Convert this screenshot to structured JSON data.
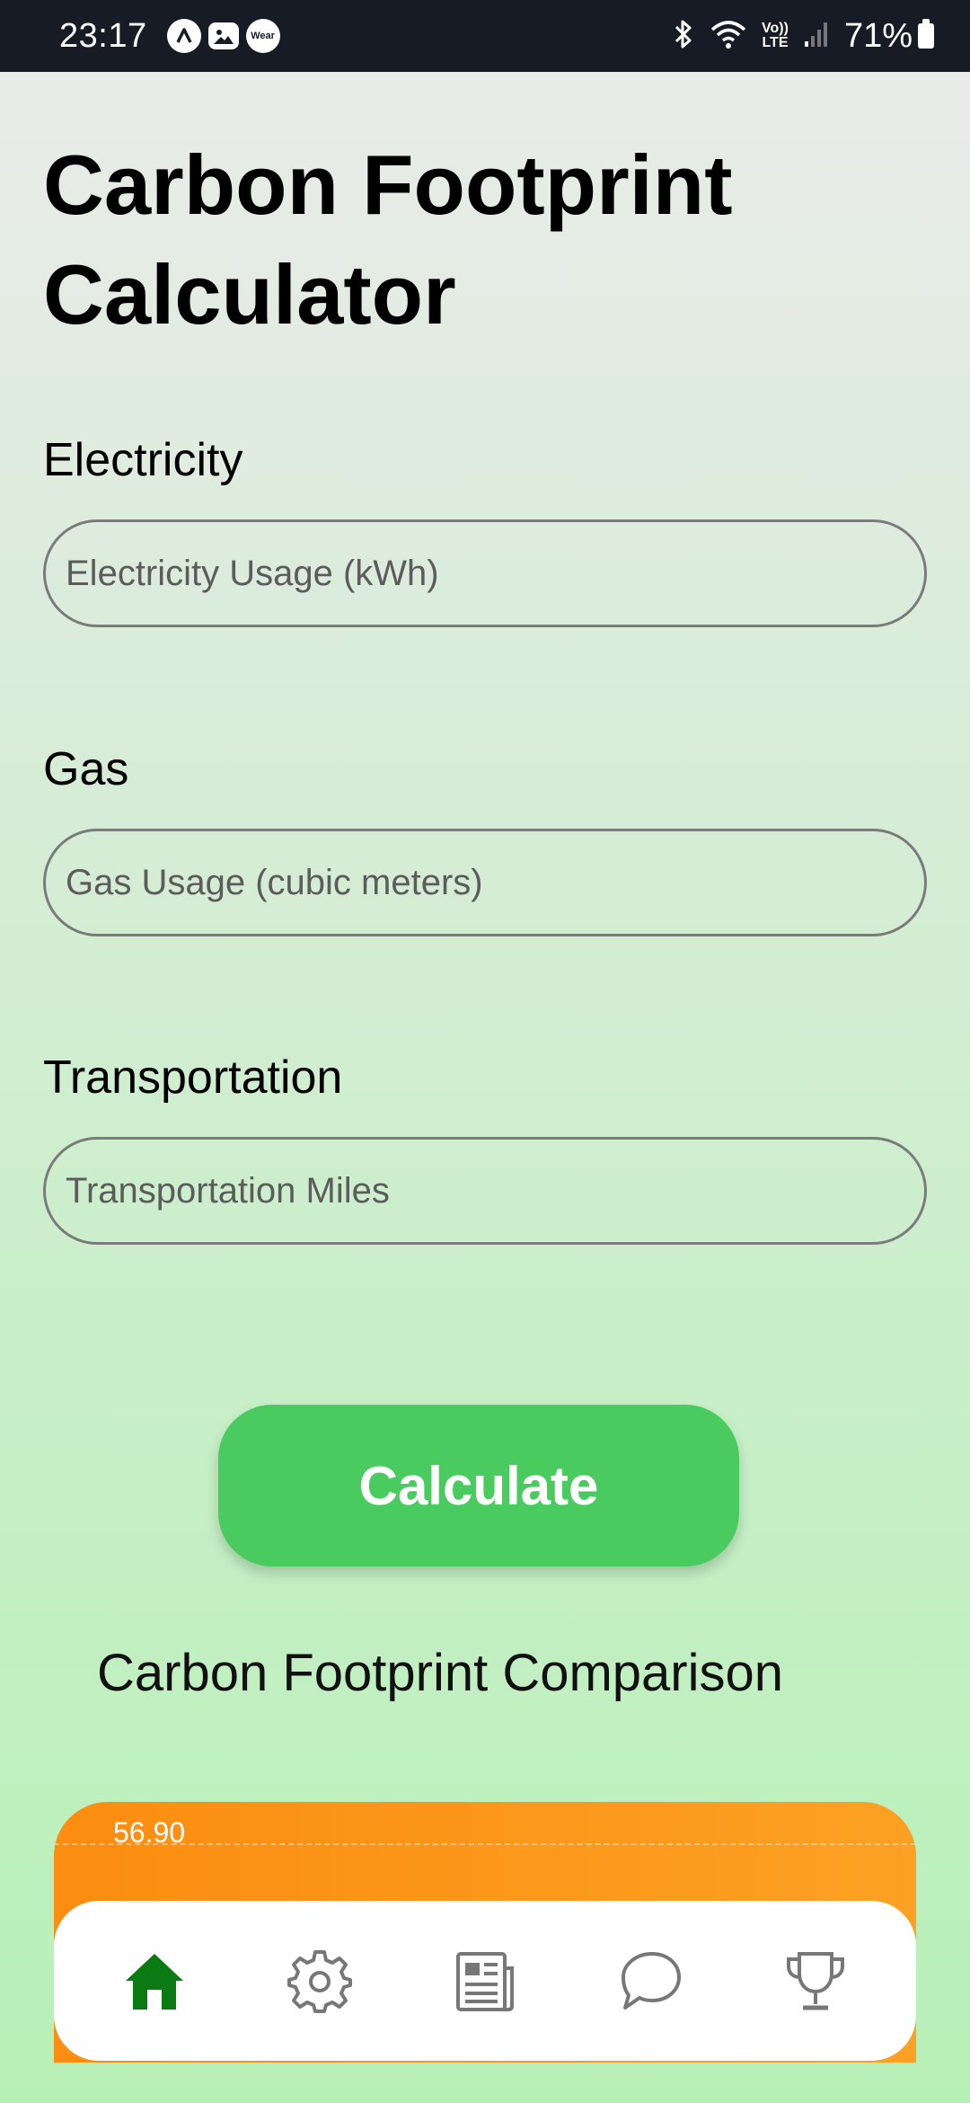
{
  "status_bar": {
    "time": "23:17",
    "notification_icons": [
      "app-a-icon",
      "image-icon",
      "wear-icon"
    ],
    "wear_label": "Wear",
    "lte_label_top": "Vo))",
    "lte_label_bottom": "LTE",
    "battery": "71%"
  },
  "page": {
    "title": "Carbon Footprint Calculator"
  },
  "form": {
    "electricity_label": "Electricity",
    "electricity_placeholder": "Electricity Usage (kWh)",
    "gas_label": "Gas",
    "gas_placeholder": "Gas Usage (cubic meters)",
    "transport_label": "Transportation",
    "transport_placeholder": "Transportation Miles",
    "calculate_label": "Calculate"
  },
  "comparison": {
    "title": "Carbon Footprint Comparison",
    "top_tick": "56.90"
  },
  "colors": {
    "accent": "#4acb5f",
    "chart": "#fb8d10",
    "active_nav": "#0a7a12",
    "inactive_nav": "#777777"
  },
  "nav": {
    "items": [
      {
        "icon": "home-icon",
        "active": true
      },
      {
        "icon": "gear-icon",
        "active": false
      },
      {
        "icon": "news-icon",
        "active": false
      },
      {
        "icon": "chat-icon",
        "active": false
      },
      {
        "icon": "trophy-icon",
        "active": false
      }
    ]
  }
}
